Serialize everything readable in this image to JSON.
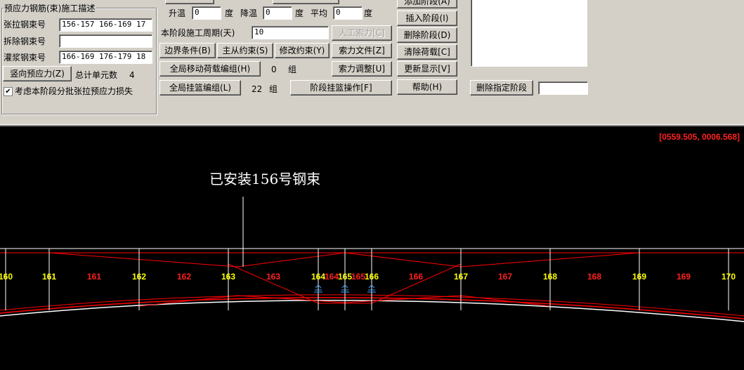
{
  "group": {
    "title": "预应力钢筋(束)施工描述"
  },
  "fields": {
    "tension": {
      "label": "张拉钢束号",
      "value": "156-157 166-169 17"
    },
    "remove": {
      "label": "拆除钢束号",
      "value": ""
    },
    "grout": {
      "label": "灌浆钢束号",
      "value": "166-169 176-179 18"
    }
  },
  "vertical_prestress_button": "竖向预应力(Z)",
  "total_elements": {
    "label": "总计单元数",
    "value": "4"
  },
  "consider_loss": {
    "label": "考虑本阶段分批张拉预应力损失",
    "checked": "✔"
  },
  "temp": {
    "rise_label": "升温",
    "rise_value": "0",
    "unit": "度",
    "fall_label": "降温",
    "fall_value": "0",
    "avg_label": "平均",
    "avg_value": "0"
  },
  "period": {
    "label": "本阶段施工周期(天)",
    "value": "10"
  },
  "buttons": {
    "manual_cable_force": "人工索力[C]",
    "boundary": "边界条件(B)",
    "master_slave": "主从约束(S)",
    "modify_constraint": "修改约束(Y)",
    "cable_file": "索力文件[Z]",
    "global_moving_load": "全局移动荷载编组(H)",
    "cable_adjust": "索力调整[U]",
    "global_basket": "全局挂篮编组(L)",
    "stage_basket": "阶段挂篮操作[F]",
    "add_stage": "添加阶段(A)",
    "insert_stage": "插入阶段(I)",
    "delete_stage": "删除阶段(D)",
    "clear_load": "清除荷载[C]",
    "refresh": "更新显示[V]",
    "help": "帮助(H)",
    "delete_specified_stage": "删除指定阶段"
  },
  "moving_load_count": {
    "value": "0",
    "unit": "组"
  },
  "basket_count": {
    "value": "22",
    "unit": "组"
  },
  "delete_stage_input": "",
  "canvas": {
    "coords": "[0559.505, 0006.568]",
    "annotation": "已安装156号钢束",
    "node_labels": [
      "160",
      "161",
      "162",
      "163",
      "164",
      "165",
      "166",
      "167",
      "168",
      "169",
      "170"
    ],
    "node_x": [
      8,
      70,
      198,
      325,
      453,
      491,
      529,
      656,
      783,
      910,
      1037
    ],
    "element_labels": [
      "161",
      "162",
      "163",
      "164",
      "165",
      "166",
      "167",
      "168",
      "169"
    ],
    "element_x": [
      134,
      262,
      389,
      472,
      510,
      592,
      719,
      846,
      973
    ],
    "colors": {
      "node": "#ffff00",
      "element": "#ff2020",
      "coords": "#ff2020",
      "line": "#ffffff",
      "tendon": "#ff0000",
      "support": "#40a0ff"
    }
  }
}
